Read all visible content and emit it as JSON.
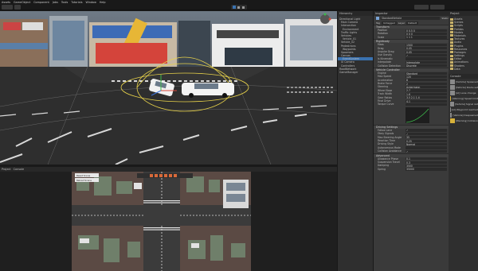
{
  "menu": [
    "Assets",
    "GameObject",
    "Component",
    "Jobs",
    "Tools",
    "Tutorials",
    "Window",
    "Help"
  ],
  "scene": {
    "tabs": [
      "Scene",
      "Game"
    ],
    "buildings": {
      "sign_left": "",
      "sign_right": ""
    }
  },
  "game_view": {
    "tabs": [
      "Project",
      "Console"
    ],
    "buttons": [
      "Reset Scene",
      "Reload Scene"
    ],
    "mini_title": ""
  },
  "hierarchy": {
    "title": "Hierarchy",
    "items": [
      "Directional Light",
      "Main Camera",
      "Intersection",
      "Environment",
      "Traffic Lights",
      "Vehicles",
      "Vehicle_01",
      "Vehicle_02",
      "Pedestrians",
      "Waypoints",
      "Spawners",
      "Canvas",
      "EventSystem",
      "UI Camera",
      "Controllers",
      "RoadNetwork",
      "GameManager"
    ],
    "selected_index": 12
  },
  "inspector": {
    "title": "Inspector",
    "object_name": "StandardVehicle",
    "static_label": "Static",
    "tag_label": "Tag",
    "tag_value": "Untagged",
    "layer_label": "Layer",
    "layer_value": "Default",
    "components": [
      {
        "name": "Transform",
        "props": [
          [
            "Position",
            "0   0.5   0"
          ],
          [
            "Rotation",
            "0   0   0"
          ],
          [
            "Scale",
            "1   1   1"
          ]
        ]
      },
      {
        "name": "Rigidbody",
        "props": [
          [
            "Mass",
            "1500"
          ],
          [
            "Drag",
            "0.05"
          ],
          [
            "Angular Drag",
            "0.05"
          ],
          [
            "Use Gravity",
            "✓"
          ],
          [
            "Is Kinematic",
            ""
          ],
          [
            "Interpolate",
            "Interpolate"
          ],
          [
            "Collision Detection",
            "Discrete"
          ]
        ]
      },
      {
        "name": "Vehicle Controller",
        "props": [
          [
            "Engine",
            "Standard"
          ],
          [
            "Max Speed",
            "120"
          ],
          [
            "Acceleration",
            "8"
          ],
          [
            "Brake Force",
            "2"
          ],
          [
            "Steering",
            "Ackermann"
          ],
          [
            "Wheel Base",
            "2.7"
          ],
          [
            "Track Width",
            "1.6"
          ],
          [
            "Gear Ratios",
            "3.5   2.1   1.4"
          ],
          [
            "Final Drive",
            "4.1"
          ],
          [
            "Torque Curve",
            ""
          ]
        ]
      },
      {
        "name": "Driving Settings",
        "props": [
          [
            "Follow Lane",
            "✓"
          ],
          [
            "Obey Signals",
            "✓"
          ],
          [
            "Max Steering Angle",
            "35"
          ],
          [
            "Reaction Time",
            "0.25"
          ],
          [
            "Driving Style",
            "Normal"
          ],
          [
            "Autonomous Mode",
            ""
          ],
          [
            "Collision Avoidance",
            "✓"
          ]
        ]
      },
      {
        "name": "Advanced",
        "props": [
          [
            "Allowance Phase",
            "0.1"
          ],
          [
            "Suspension Travel",
            "0.3"
          ],
          [
            "Damping",
            "3500"
          ],
          [
            "Spring",
            "35000"
          ]
        ]
      }
    ],
    "curve_label": "Torque Curve"
  },
  "project": {
    "title": "Project",
    "tree": [
      "Assets",
      "Scenes",
      "Scripts",
      "Prefabs",
      "Models",
      "Materials",
      "Textures",
      "Audio",
      "Plugins",
      "Resources",
      "Packages",
      "Settings",
      "Editor",
      "Animations",
      "Shaders",
      "Data"
    ],
    "console_title": "Console",
    "logs": [
      "[Vehicle] Spawned",
      "[Vehicle] Route set",
      "[AI] Lane change",
      "[Warning] Speed limit",
      "[Vehicle] Signal red",
      "[AI] Waypoint reached",
      "[Vehicle] Despawned",
      "[Warning] Collision"
    ],
    "log_kinds": [
      "info",
      "info",
      "info",
      "warn",
      "info",
      "info",
      "info",
      "warn"
    ]
  },
  "colors": {
    "accent": "#3a72b0",
    "gizmo": "#e8d24a",
    "road": "#2b2b2b"
  }
}
